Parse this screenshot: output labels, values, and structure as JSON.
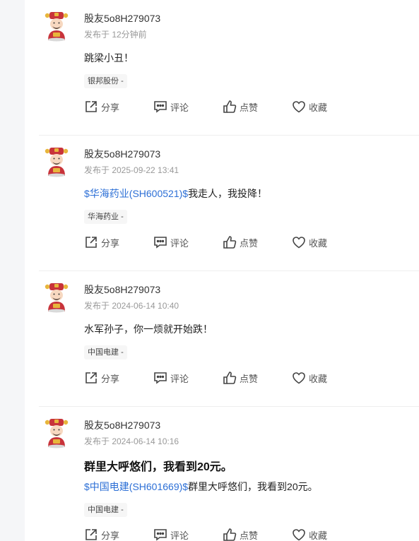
{
  "posts": [
    {
      "author": "股友5o8H279073",
      "time": "发布于 12分钟前",
      "content": "跳梁小丑！",
      "tag": "银邦股份",
      "tag_suffix": "-"
    },
    {
      "author": "股友5o8H279073",
      "time": "发布于 2025-09-22 13:41",
      "stock_link": "$华海药业(SH600521)$",
      "content": "我走人，我投降！",
      "tag": "华海药业",
      "tag_suffix": "-"
    },
    {
      "author": "股友5o8H279073",
      "time": "发布于 2024-06-14 10:40",
      "content": "水军孙子，你一烦就开始跌！",
      "tag": "中国电建",
      "tag_suffix": "-"
    },
    {
      "author": "股友5o8H279073",
      "time": "发布于 2024-06-14 10:16",
      "headline": "群里大呼悠们，我看到20元。",
      "stock_link": "$中国电建(SH601669)$",
      "content": "群里大呼悠们，我看到20元。",
      "tag": "中国电建",
      "tag_suffix": "-"
    }
  ],
  "actions": {
    "share": "分享",
    "comment": "评论",
    "like": "点赞",
    "collect": "收藏"
  },
  "colors": {
    "link": "#2c6fd6",
    "muted": "#999999",
    "accent_avatar": "#c8333a"
  },
  "icons": [
    "share-icon",
    "comment-icon",
    "like-icon",
    "collect-icon"
  ]
}
